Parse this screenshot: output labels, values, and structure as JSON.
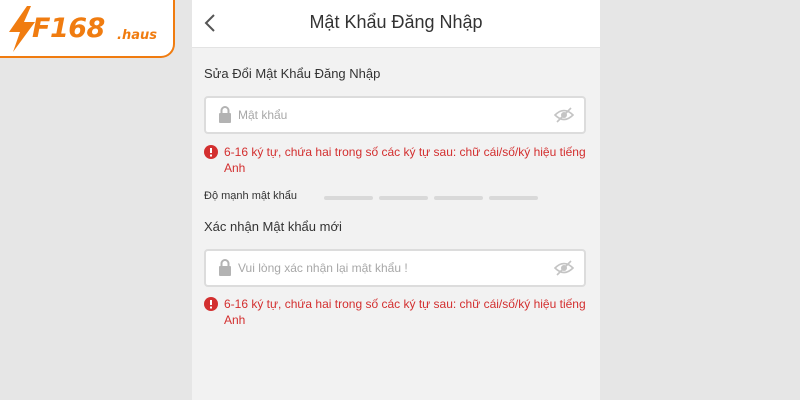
{
  "logo": {
    "brand": "F168",
    "suffix": ".haus",
    "color": "#f07c10"
  },
  "header": {
    "title": "Mật Khẩu Đăng Nhập",
    "back_icon": "chevron-left-icon"
  },
  "form": {
    "change_label": "Sửa Đổi Mật Khẩu Đăng Nhập",
    "password": {
      "placeholder": "Mật khẩu",
      "value": ""
    },
    "password_hint": "6-16 ký tự, chứa hai trong số các ký tự sau: chữ cái/số/ký hiệu tiếng Anh",
    "strength_label": "Độ mạnh mật khẩu",
    "strength_segments": 4,
    "strength_level": 0,
    "confirm_label": "Xác nhận Mật khẩu mới",
    "confirm": {
      "placeholder": "Vui lòng xác nhận lại mật khẩu !",
      "value": ""
    },
    "confirm_hint": "6-16 ký tự, chứa hai trong số các ký tự sau: chữ cái/số/ký hiệu tiếng Anh"
  },
  "colors": {
    "error": "#d32f2f",
    "accent": "#f07c10"
  }
}
